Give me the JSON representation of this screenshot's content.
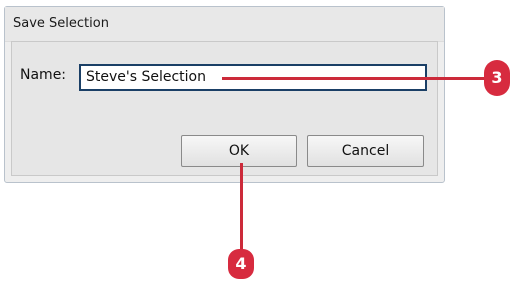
{
  "dialog": {
    "title": "Save Selection",
    "name_label": "Name:",
    "name_value": "Steve's Selection",
    "ok_label": "OK",
    "cancel_label": "Cancel"
  },
  "callouts": {
    "name_field_step": "3",
    "ok_button_step": "4"
  },
  "colors": {
    "callout": "#d72b3f",
    "field_border": "#1a3f66"
  }
}
